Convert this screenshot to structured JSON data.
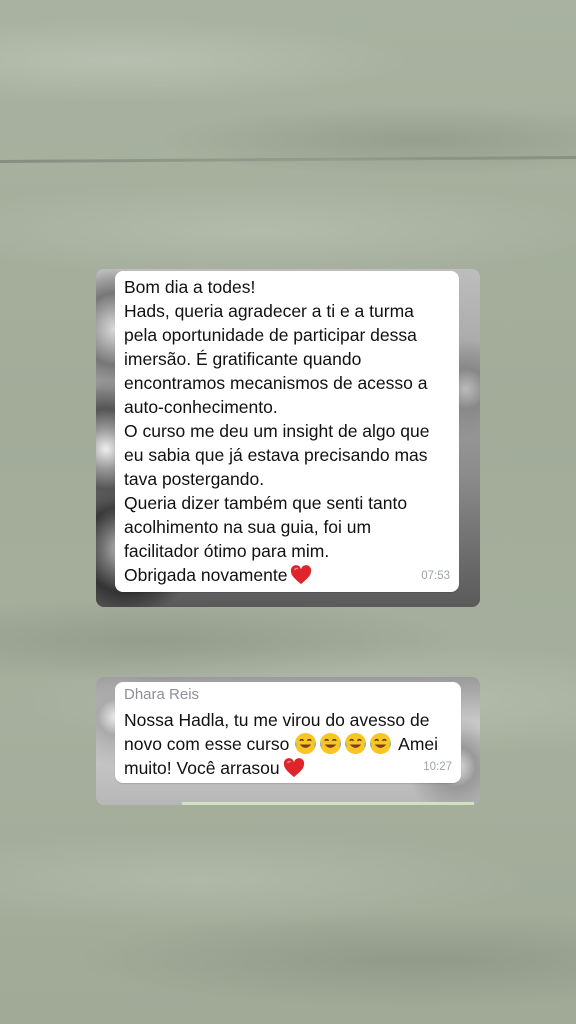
{
  "messages": [
    {
      "lines": [
        "Bom dia a todes!",
        "Hads, queria agradecer a ti e a turma",
        "pela oportunidade de participar dessa",
        "imersão. É gratificante quando",
        "encontramos mecanismos de acesso a",
        "auto-conhecimento.",
        "O curso me deu um insight de algo que",
        "eu sabia que já estava precisando mas",
        "tava postergando.",
        "Queria dizer também que senti tanto",
        "acolhimento na sua guia, foi um",
        "facilitador ótimo para mim.",
        "Obrigada novamente"
      ],
      "emoji_end": "heart-icon",
      "time": "07:53"
    },
    {
      "sender": "Dhara Reis",
      "line1": "Nossa Hadla, tu me virou do avesso de",
      "line2_before": "novo com esse curso",
      "line2_emoji": "face-with-tears-of-joy-icon",
      "line2_emoji_count": 4,
      "line2_after": "Amei",
      "line3": "muito! Você arrasou",
      "emoji_end": "heart-icon",
      "time": "10:27"
    }
  ],
  "colors": {
    "background": "#a3ad9b",
    "bubble": "#ffffff",
    "sender_name": "#8e8f9a",
    "timestamp": "#9fa3a6",
    "heart": "#e0242b"
  }
}
